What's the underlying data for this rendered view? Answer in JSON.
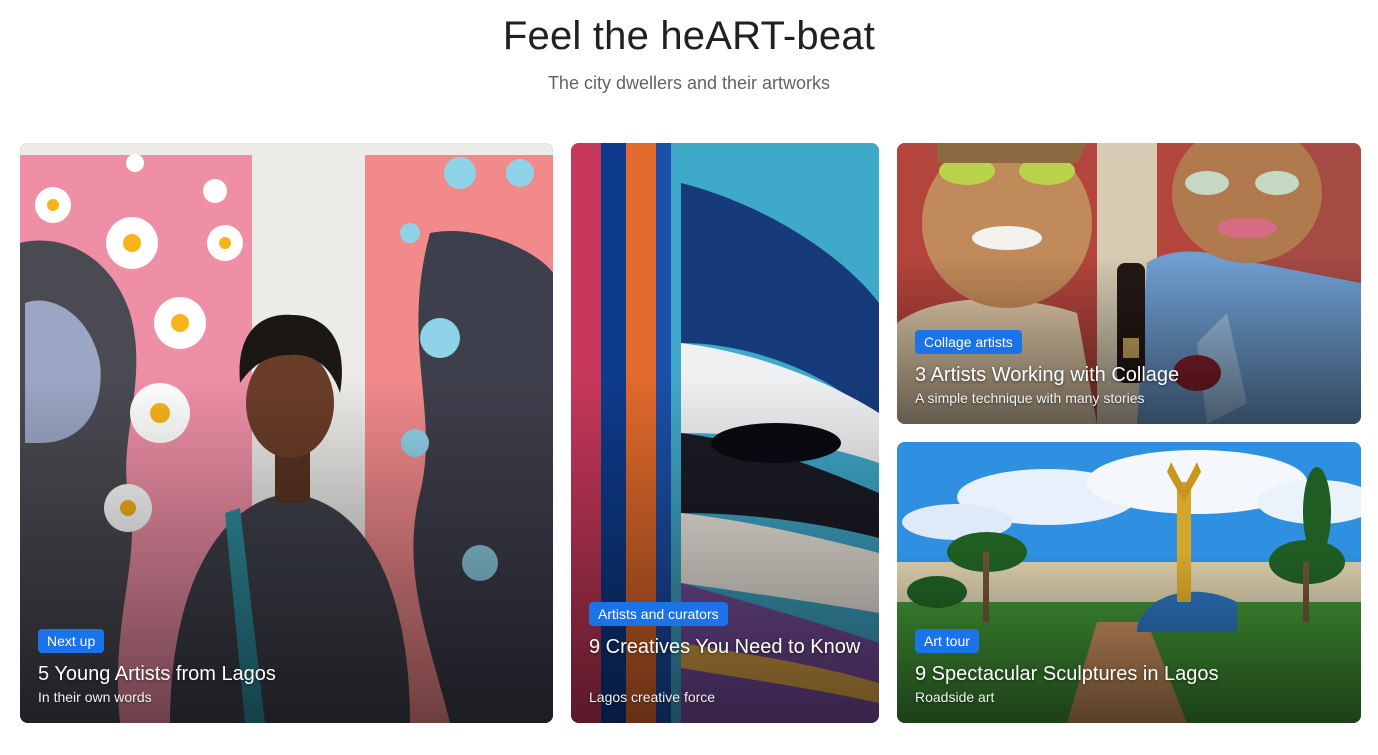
{
  "header": {
    "title": "Feel the heART-beat",
    "subtitle": "The city dwellers and their artworks"
  },
  "cards": [
    {
      "chip": "Next up",
      "title": "5 Young Artists from Lagos",
      "subtitle": "In their own words"
    },
    {
      "chip": "Artists and curators",
      "title": "9 Creatives You Need to Know",
      "subtitle": "Lagos creative force"
    },
    {
      "chip": "Collage artists",
      "title": "3 Artists Working with Collage",
      "subtitle": "A simple technique with many stories"
    },
    {
      "chip": "Art tour",
      "title": "9 Spectacular Sculptures in Lagos",
      "subtitle": "Roadside art"
    }
  ],
  "colors": {
    "chip": "#1a73e8",
    "title": "#202124",
    "subtitle": "#5f6368"
  }
}
